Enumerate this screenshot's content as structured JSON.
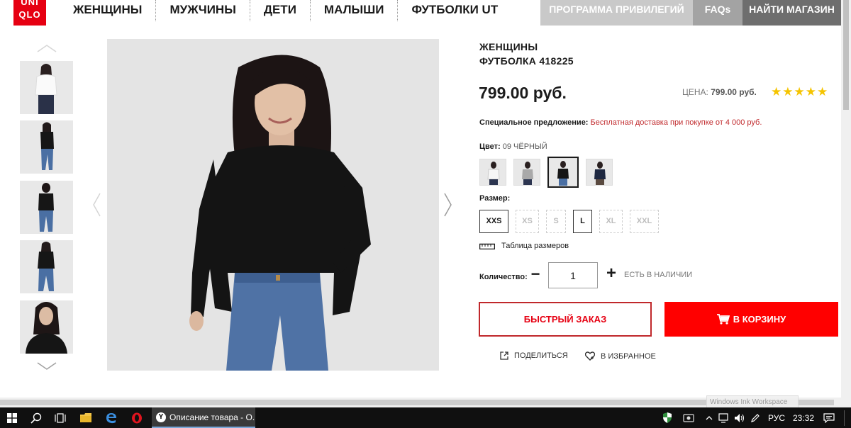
{
  "header": {
    "logo_top": "UNI",
    "logo_bottom": "QLO",
    "nav": [
      "ЖЕНЩИНЫ",
      "МУЖЧИНЫ",
      "ДЕТИ",
      "МАЛЫШИ",
      "ФУТБОЛКИ UT"
    ],
    "privileges": "ПРОГРАММА ПРИВИЛЕГИЙ",
    "faqs": "FAQs",
    "find_store": "НАЙТИ МАГАЗИН"
  },
  "product": {
    "category": "ЖЕНЩИНЫ",
    "name": "ФУТБОЛКА 418225",
    "price": "799.00 руб.",
    "orig_price_label": "ЦЕНА:",
    "orig_price": "799.00 руб.",
    "rating": "★★★★★",
    "offer_label": "Специальное предложение:",
    "offer_text": "Бесплатная доставка при покупке от 4 000 руб.",
    "color_label": "Цвет:",
    "color_value": "09 ЧЁРНЫЙ",
    "size_label": "Размер:",
    "sizes": [
      {
        "label": "XXS",
        "available": true
      },
      {
        "label": "XS",
        "available": false
      },
      {
        "label": "S",
        "available": false
      },
      {
        "label": "L",
        "available": true
      },
      {
        "label": "XL",
        "available": false
      },
      {
        "label": "XXL",
        "available": false
      }
    ],
    "size_table": "Таблица размеров",
    "qty_label": "Количество:",
    "qty_value": "1",
    "stock": "ЕСТЬ В НАЛИЧИИ",
    "quick_order": "БЫСТРЫЙ ЗАКАЗ",
    "add_to_cart": "В КОРЗИНУ",
    "share": "ПОДЕЛИТЬСЯ",
    "favorite": "В ИЗБРАННОЕ"
  },
  "swatch_colors": [
    "#f4f4f4",
    "#a9a9a9",
    "#1a1a1a",
    "#1d2740"
  ],
  "colors": {
    "accent": "#e60012",
    "cart": "#ff0000",
    "offer": "#c0282b",
    "star": "#f5c400"
  },
  "overlay": {
    "ink_workspace": "Windows Ink Workspace"
  },
  "taskbar": {
    "task_title": "Описание товара - О...",
    "lang": "РУС",
    "time": "23:32"
  }
}
